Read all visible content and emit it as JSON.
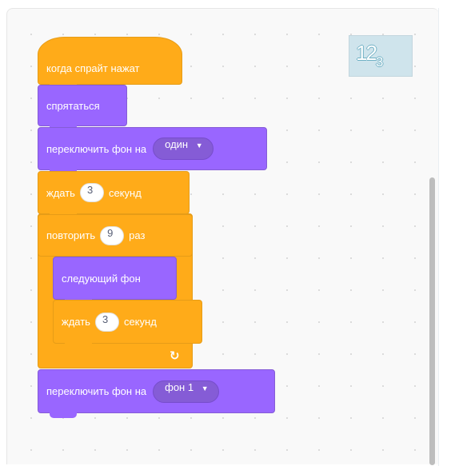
{
  "workspace": {
    "sprite_thumbnail": {
      "main": "12",
      "sub": "3"
    }
  },
  "blocks": {
    "when_clicked": {
      "label": "когда спрайт нажат"
    },
    "hide": {
      "label": "спрятаться"
    },
    "switch_backdrop_1": {
      "label": "переключить фон на",
      "value": "один"
    },
    "wait_1": {
      "label": "ждать",
      "value": "3",
      "suffix": "секунд"
    },
    "repeat": {
      "label": "повторить",
      "value": "9",
      "suffix": "раз"
    },
    "next_backdrop": {
      "label": "следующий фон"
    },
    "wait_2": {
      "label": "ждать",
      "value": "3",
      "suffix": "секунд"
    },
    "loop_arrow": "↻",
    "switch_backdrop_2": {
      "label": "переключить фон на",
      "value": "фон 1"
    }
  },
  "colors": {
    "looks": "#9966ff",
    "looks_dark": "#855cd6",
    "events": "#ffab19",
    "control": "#ffab19",
    "workspace_bg": "#f9f9f9"
  },
  "icons": {
    "dropdown_caret": "▼",
    "loop_arrow": "↻"
  }
}
